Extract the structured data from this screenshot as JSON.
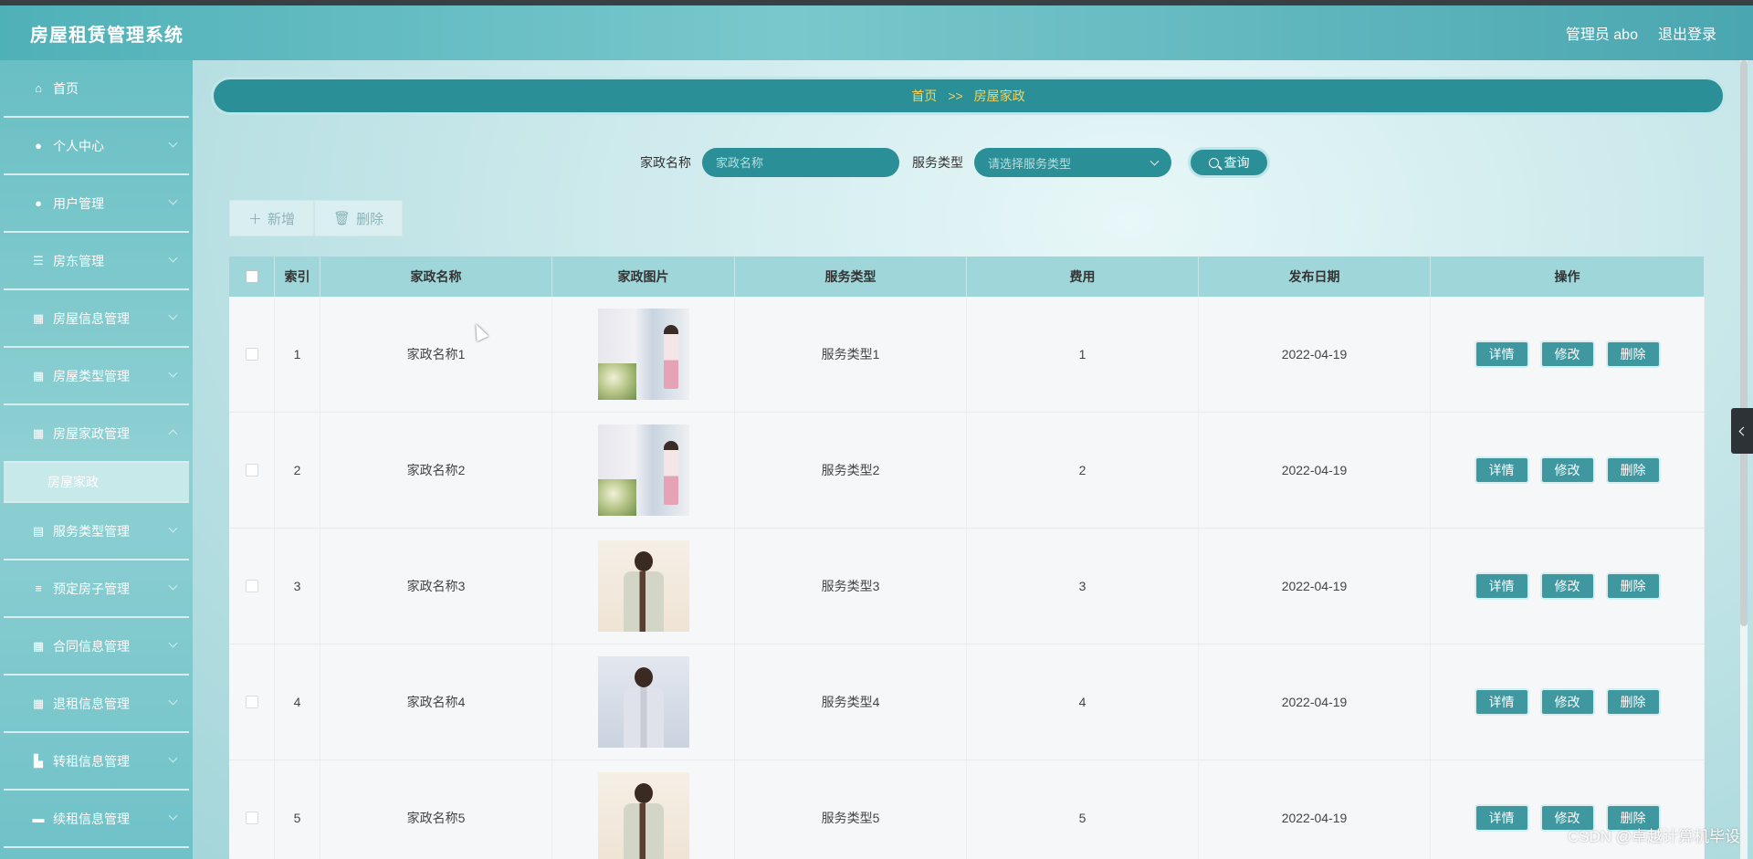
{
  "app": {
    "title": "房屋租赁管理系统"
  },
  "header": {
    "admin_label": "管理员 abo",
    "logout_label": "退出登录"
  },
  "sidebar": {
    "items": [
      {
        "label": "首页",
        "icon": "home-icon",
        "glyph": "⌂"
      },
      {
        "label": "个人中心",
        "icon": "user-icon",
        "glyph": "●"
      },
      {
        "label": "用户管理",
        "icon": "location-pin-icon",
        "glyph": "●"
      },
      {
        "label": "房东管理",
        "icon": "list-icon",
        "glyph": "☰"
      },
      {
        "label": "房屋信息管理",
        "icon": "grid-icon",
        "glyph": "▦"
      },
      {
        "label": "房屋类型管理",
        "icon": "grid-icon",
        "glyph": "▦"
      },
      {
        "label": "房屋家政管理",
        "icon": "apps-icon",
        "glyph": "▦"
      }
    ],
    "active_sub": "房屋家政",
    "items_after": [
      {
        "label": "服务类型管理",
        "icon": "printer-icon",
        "glyph": "▤"
      },
      {
        "label": "预定房子管理",
        "icon": "sliders-icon",
        "glyph": "≡"
      },
      {
        "label": "合同信息管理",
        "icon": "grid-icon",
        "glyph": "▦"
      },
      {
        "label": "退租信息管理",
        "icon": "grid-icon",
        "glyph": "▦"
      },
      {
        "label": "转租信息管理",
        "icon": "home-chart-icon",
        "glyph": "▙"
      },
      {
        "label": "续租信息管理",
        "icon": "comment-icon",
        "glyph": "▬"
      }
    ]
  },
  "breadcrumb": {
    "home": "首页",
    "sep": ">>",
    "current": "房屋家政"
  },
  "search": {
    "name_label": "家政名称",
    "name_placeholder": "家政名称",
    "type_label": "服务类型",
    "type_placeholder": "请选择服务类型",
    "query_label": "查询"
  },
  "actions": {
    "add_label": "新增",
    "delete_label": "删除"
  },
  "table": {
    "columns": [
      "索引",
      "家政名称",
      "家政图片",
      "服务类型",
      "费用",
      "发布日期",
      "操作"
    ],
    "rows": [
      {
        "index": "1",
        "name": "家政名称1",
        "image": "window-cleaning",
        "type": "服务类型1",
        "fee": "1",
        "date": "2022-04-19"
      },
      {
        "index": "2",
        "name": "家政名称2",
        "image": "window-cleaning",
        "type": "服务类型2",
        "fee": "2",
        "date": "2022-04-19"
      },
      {
        "index": "3",
        "name": "家政名称3",
        "image": "housekeeper-uniform",
        "type": "服务类型3",
        "fee": "3",
        "date": "2022-04-19"
      },
      {
        "index": "4",
        "name": "家政名称4",
        "image": "housekeeper-blue",
        "type": "服务类型4",
        "fee": "4",
        "date": "2022-04-19"
      },
      {
        "index": "5",
        "name": "家政名称5",
        "image": "housekeeper-uniform",
        "type": "服务类型5",
        "fee": "5",
        "date": "2022-04-19"
      }
    ],
    "row_actions": {
      "detail": "详情",
      "edit": "修改",
      "delete": "删除"
    }
  },
  "watermark": "CSDN @卓越计算机毕设"
}
